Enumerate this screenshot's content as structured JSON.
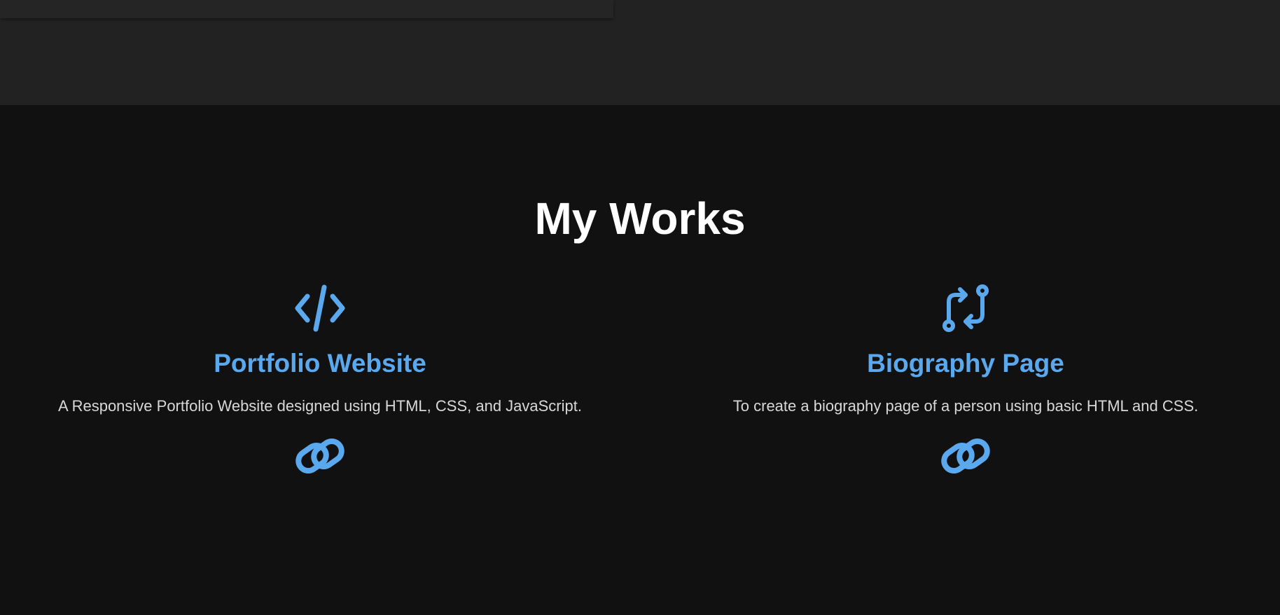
{
  "theme": {
    "accent": "#5aa9ee",
    "background": "#111111",
    "header_background": "#222222",
    "text": "#ffffff",
    "muted_text": "#d8d8d8"
  },
  "works": {
    "title": "My Works",
    "items": [
      {
        "icon": "code-icon",
        "title": "Portfolio Website",
        "description": "A Responsive Portfolio Website designed using HTML, CSS, and JavaScript.",
        "link_icon": "link-icon"
      },
      {
        "icon": "git-compare-icon",
        "title": "Biography Page",
        "description": "To create a biography page of a person using basic HTML and CSS.",
        "link_icon": "link-icon"
      }
    ]
  }
}
